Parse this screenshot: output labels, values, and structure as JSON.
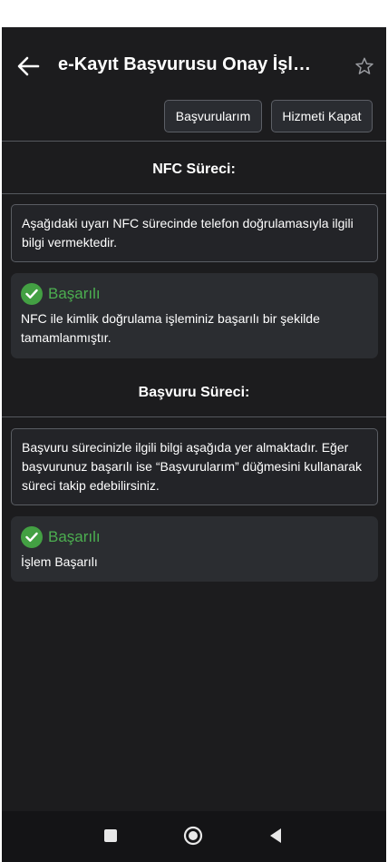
{
  "header": {
    "title": "e-Kayıt Başvurusu Onay İşl…",
    "back_icon": "arrow-left-icon",
    "star_icon": "star-outline-icon"
  },
  "toolbar": {
    "applications_label": "Başvurularım",
    "close_service_label": "Hizmeti Kapat"
  },
  "nfc": {
    "title": "NFC Süreci:",
    "info": "Aşağıdaki uyarı NFC sürecinde telefon doğrulamasıyla ilgili bilgi vermektedir.",
    "status_label": "Başarılı",
    "status_message": "NFC ile kimlik doğrulama işleminiz başarılı bir şekilde tamamlanmıştır."
  },
  "application": {
    "title": "Başvuru Süreci:",
    "info": "Başvuru sürecinizle ilgili bilgi aşağıda yer almaktadır. Eğer başvurunuz başarılı ise “Başvurularım” düğmesini kullanarak süreci takip edebilirsiniz.",
    "status_label": "Başarılı",
    "status_message": "İşlem Başarılı"
  },
  "colors": {
    "background": "#1c1c1e",
    "success": "#4caf50",
    "text": "#ffffff"
  }
}
